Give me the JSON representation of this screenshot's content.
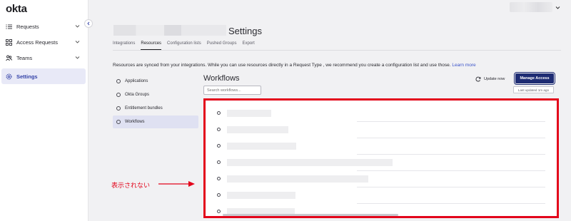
{
  "app": {
    "logo": "okta"
  },
  "sidebar": {
    "items": [
      {
        "label": "Requests",
        "icon": "list-icon",
        "expandable": true
      },
      {
        "label": "Access Requests",
        "icon": "grid-icon",
        "expandable": true
      },
      {
        "label": "Teams",
        "icon": "people-icon",
        "expandable": true
      },
      {
        "label": "Settings",
        "icon": "gear-icon",
        "active": true
      }
    ]
  },
  "header": {
    "title": "Settings",
    "tabs": [
      {
        "label": "Integrations"
      },
      {
        "label": "Resources",
        "active": true
      },
      {
        "label": "Configuration lists"
      },
      {
        "label": "Pushed Groups"
      },
      {
        "label": "Export"
      }
    ]
  },
  "info": {
    "text": "Resources are synced from your integrations. While you can use resources directly in a Request Type , we recommend you create a configuration list and use those. ",
    "link": "Learn more"
  },
  "resources": [
    {
      "label": "Applications"
    },
    {
      "label": "Okta Groups"
    },
    {
      "label": "Entitlement bundles"
    },
    {
      "label": "Workflows",
      "active": true
    }
  ],
  "workflows": {
    "title": "Workflows",
    "search_placeholder": "Search workflows...",
    "update_label": "Update now",
    "manage_label": "Manage Access",
    "last_updated": "Last updated 1m ago",
    "rows": 7
  },
  "annotation": {
    "text": "表示されない",
    "color": "#e3051b"
  },
  "colors": {
    "accent": "#1e2c73",
    "highlight": "#e3051b",
    "active_bg": "#e8e9f7"
  }
}
